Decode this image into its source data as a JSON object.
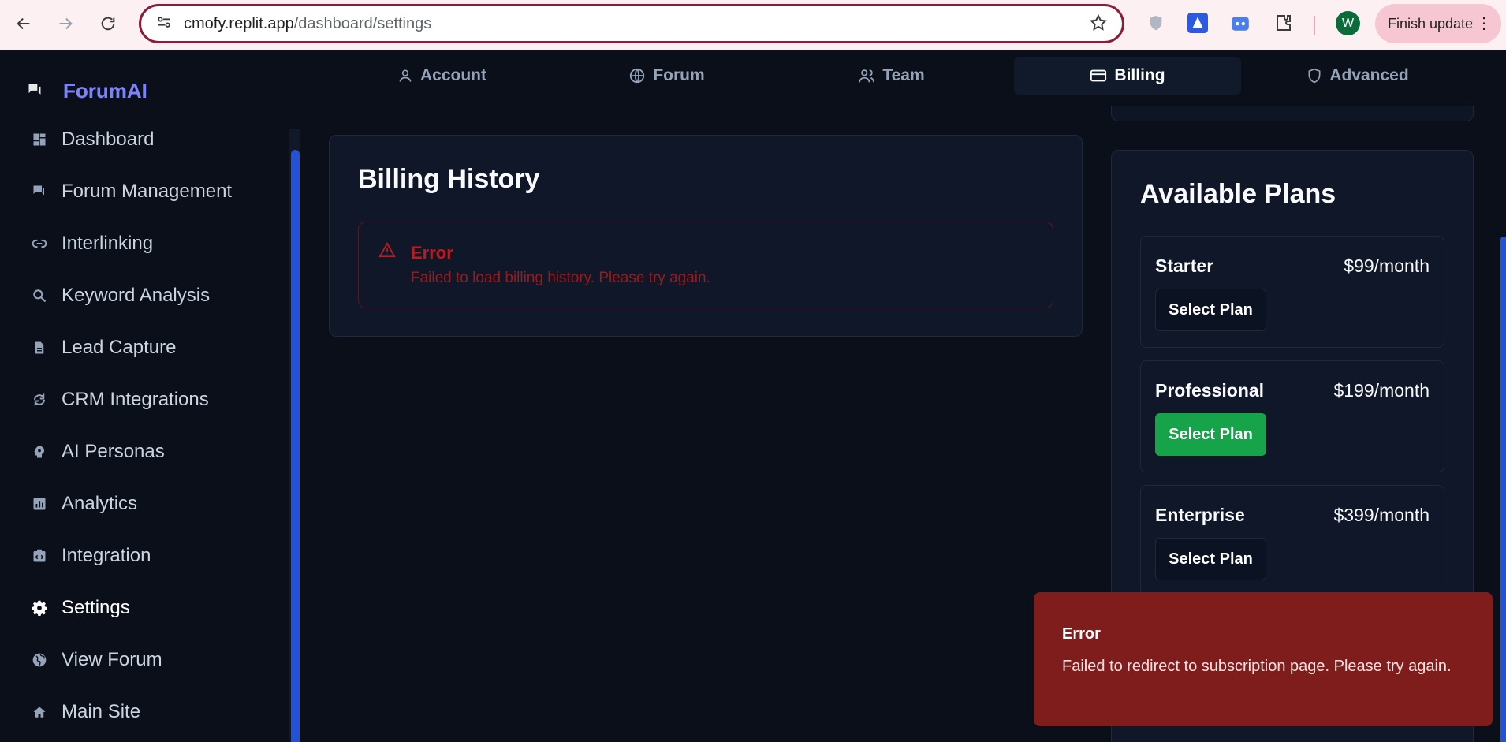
{
  "browser": {
    "url_host": "cmofy.replit.app",
    "url_path": "/dashboard/settings",
    "profile_initial": "W",
    "finish_update_label": "Finish update"
  },
  "sidebar": {
    "brand": "ForumAI",
    "items": [
      {
        "label": "Dashboard",
        "icon": "dashboard-icon"
      },
      {
        "label": "Forum Management",
        "icon": "chat-icon"
      },
      {
        "label": "Interlinking",
        "icon": "link-icon"
      },
      {
        "label": "Keyword Analysis",
        "icon": "search-icon"
      },
      {
        "label": "Lead Capture",
        "icon": "document-icon"
      },
      {
        "label": "CRM Integrations",
        "icon": "sync-icon"
      },
      {
        "label": "AI Personas",
        "icon": "persona-icon"
      },
      {
        "label": "Analytics",
        "icon": "analytics-icon"
      },
      {
        "label": "Integration",
        "icon": "integration-icon"
      },
      {
        "label": "Settings",
        "icon": "gear-icon"
      },
      {
        "label": "View Forum",
        "icon": "globe-icon"
      },
      {
        "label": "Main Site",
        "icon": "home-icon"
      }
    ],
    "active_index": 9
  },
  "tabs": [
    {
      "label": "Account",
      "icon": "user-icon"
    },
    {
      "label": "Forum",
      "icon": "globe-icon"
    },
    {
      "label": "Team",
      "icon": "users-icon"
    },
    {
      "label": "Billing",
      "icon": "credit-card-icon"
    },
    {
      "label": "Advanced",
      "icon": "shield-icon"
    }
  ],
  "active_tab": "Billing",
  "billing_history": {
    "title": "Billing History",
    "error_title": "Error",
    "error_message": "Failed to load billing history. Please try again."
  },
  "plans": {
    "title": "Available Plans",
    "items": [
      {
        "name": "Starter",
        "price": "$99/month",
        "button": "Select Plan"
      },
      {
        "name": "Professional",
        "price": "$199/month",
        "button": "Select Plan"
      },
      {
        "name": "Enterprise",
        "price": "$399/month",
        "button": "Select Plan"
      }
    ],
    "highlighted": "Professional"
  },
  "toast": {
    "title": "Error",
    "message": "Failed to redirect to subscription page. Please try again."
  },
  "colors": {
    "background": "#0b0f1a",
    "brand": "#7c83f7",
    "primary_button": "#16a34a",
    "toast_bg": "#7f1d1d",
    "error_text": "#b91c1c",
    "scrollbar": "#2451d9"
  }
}
